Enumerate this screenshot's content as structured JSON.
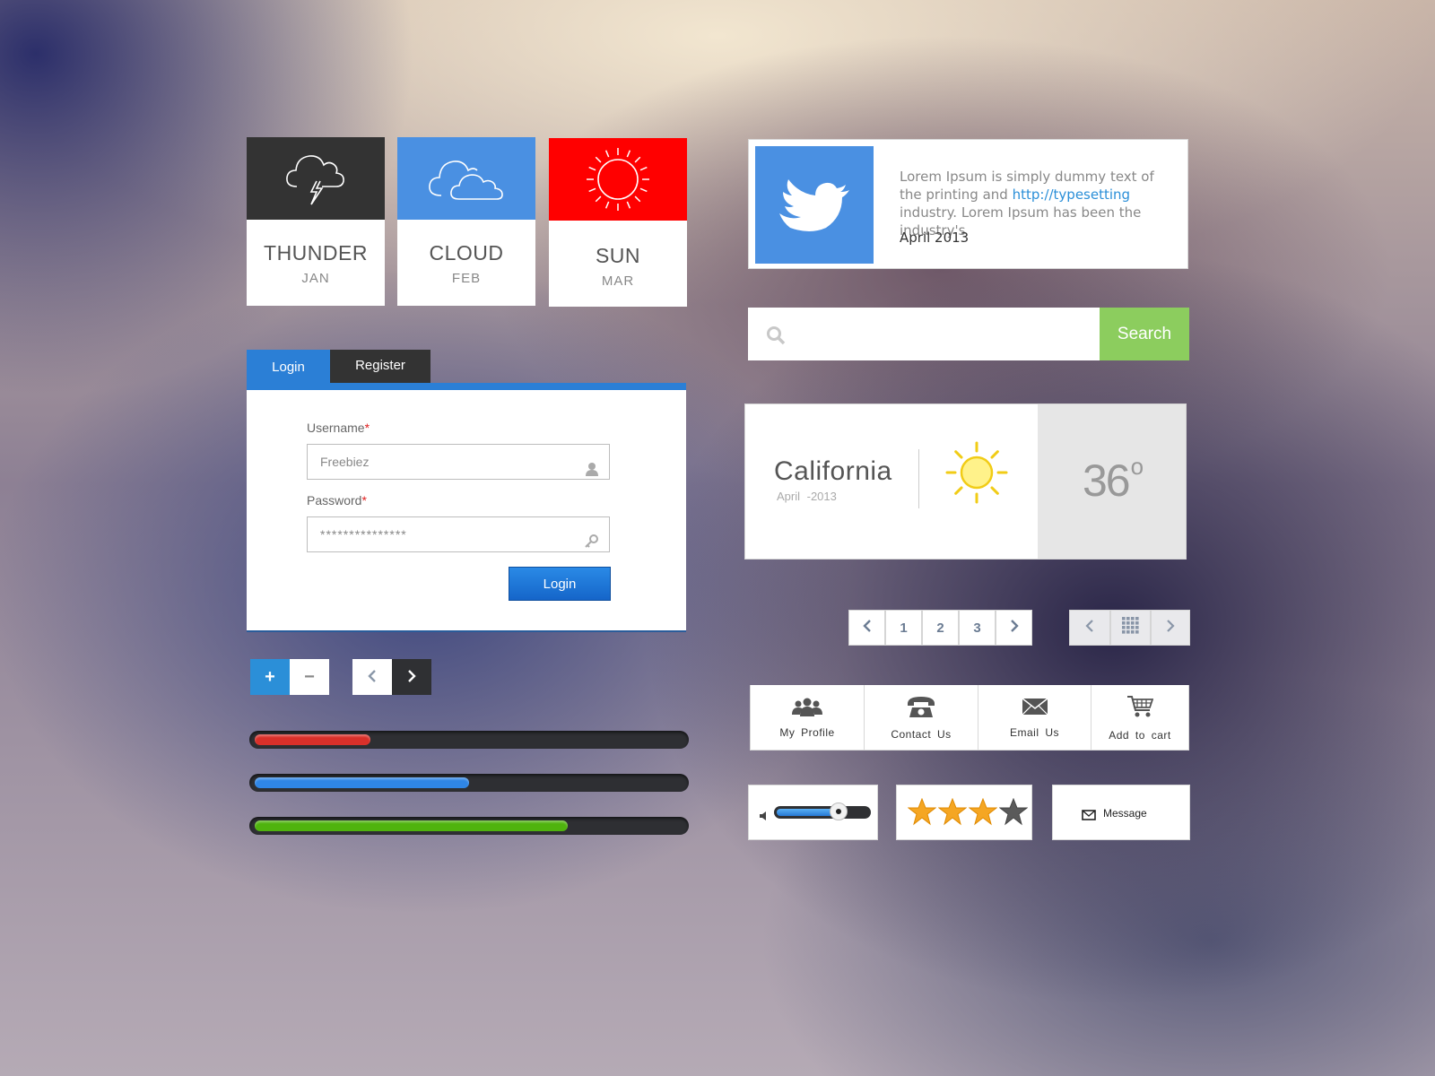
{
  "weather_tiles": [
    {
      "name": "THUNDER",
      "month": "JAN",
      "icon": "thunder-cloud-icon",
      "color": "#333333"
    },
    {
      "name": "CLOUD",
      "month": "FEB",
      "icon": "cloud-icon",
      "color": "#4a90e2"
    },
    {
      "name": "SUN",
      "month": "MAR",
      "icon": "sun-icon",
      "color": "#ff0000"
    }
  ],
  "login": {
    "tab_login": "Login",
    "tab_register": "Register",
    "username_label": "Username",
    "password_label": "Password",
    "required_mark": "*",
    "username_value": "Freebiez",
    "password_value": "***************",
    "submit_label": "Login",
    "accent": "#2b7fd6"
  },
  "steppers": {
    "plus": "+",
    "minus": "−"
  },
  "progress_bars": [
    {
      "fraction": 0.27,
      "color": "#d9302a"
    },
    {
      "fraction": 0.5,
      "color": "#2f86e6"
    },
    {
      "fraction": 0.73,
      "color": "#4fb30e"
    }
  ],
  "tweet": {
    "text_before": "Lorem Ipsum is simply dummy text of the printing and ",
    "link": "http://typesetting",
    "text_after": " industry. Lorem Ipsum has been the industry's",
    "date": "April 2013",
    "icon": "twitter-bird-icon",
    "color": "#4a90e2"
  },
  "search": {
    "placeholder": "",
    "button_label": "Search",
    "button_color": "#8ccd5e"
  },
  "weather_widget": {
    "city": "California",
    "date": "April -2013",
    "temperature": "36",
    "unit": "o"
  },
  "pagination": {
    "pages": [
      "1",
      "2",
      "3"
    ]
  },
  "actions": [
    {
      "label": "My Profile",
      "icon": "group-icon"
    },
    {
      "label": "Contact Us",
      "icon": "phone-icon"
    },
    {
      "label": "Email Us",
      "icon": "envelope-icon"
    },
    {
      "label": "Add to cart",
      "icon": "cart-icon"
    }
  ],
  "volume": {
    "level": 0.68
  },
  "rating": {
    "value": 3,
    "max": 4,
    "color": "#f5a623"
  },
  "message": {
    "label": "Message"
  }
}
